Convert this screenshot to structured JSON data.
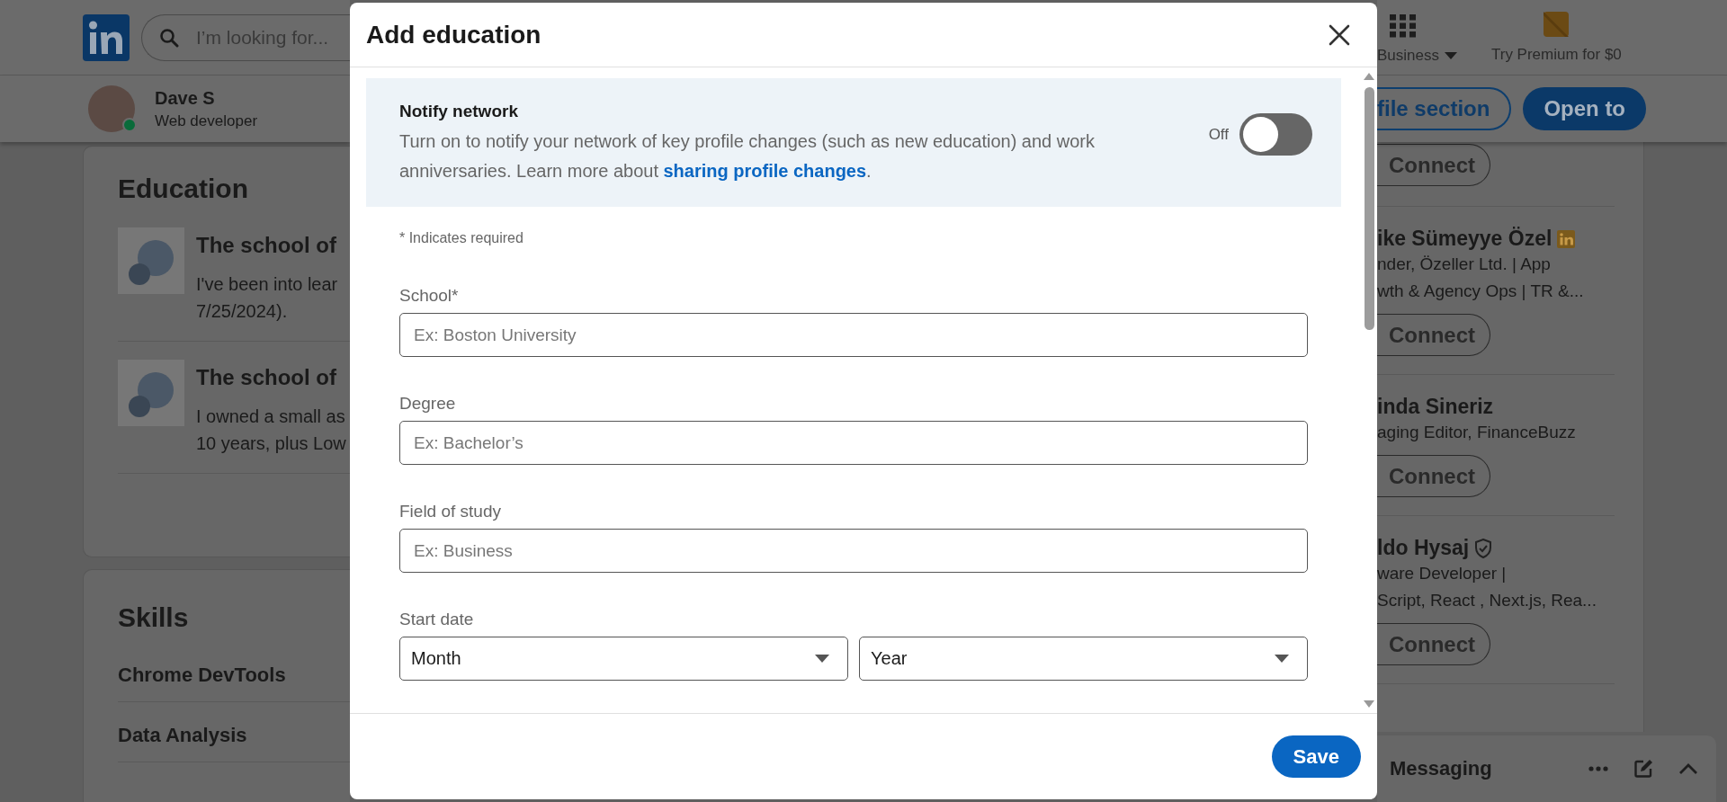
{
  "background_page": {
    "nav": {
      "search_placeholder": "I’m looking for...",
      "business_label": "Business",
      "premium_label": "Try Premium for $0"
    },
    "profile_bar": {
      "name": "Dave S",
      "headline": "Web developer",
      "online": true,
      "buttons": [
        {
          "label": "file section",
          "kind": "outline"
        },
        {
          "label": "Open to",
          "kind": "filled"
        }
      ]
    },
    "education": {
      "title": "Education",
      "items": [
        {
          "title": "The school of",
          "description_lines": [
            "I've been into lear",
            "7/25/2024)."
          ]
        },
        {
          "title": "The school of",
          "description_lines": [
            "I owned a small as",
            "10 years, plus Low"
          ]
        }
      ]
    },
    "skills": {
      "title": "Skills",
      "items": [
        "Chrome DevTools",
        "Data Analysis"
      ]
    },
    "suggestions": [
      {
        "kind": "connect_only",
        "connect_label": "Connect"
      },
      {
        "kind": "premium",
        "name": "ike Sümeyye Özel",
        "headline_lines": [
          "nder, Özeller Ltd. | App",
          "wth & Agency Ops | TR &..."
        ],
        "connect_label": "Connect"
      },
      {
        "kind": "plain",
        "name": "inda Sineriz",
        "headline_lines": [
          "aging Editor, FinanceBuzz"
        ],
        "connect_label": "Connect"
      },
      {
        "kind": "verified",
        "name": "ldo Hysaj",
        "headline_lines": [
          "ware Developer |",
          "Script, React , Next.js, Rea..."
        ],
        "connect_label": "Connect"
      }
    ],
    "messaging": {
      "label": "Messaging"
    }
  },
  "modal": {
    "title": "Add education",
    "notify": {
      "title": "Notify network",
      "text_before": "Turn on to notify your network of key profile changes (such as new education) and work anniversaries. Learn more about ",
      "link": "sharing profile changes",
      "text_after": ".",
      "toggle_label": "Off",
      "on": false
    },
    "required_note": "* Indicates required",
    "fields": [
      {
        "kind": "text",
        "label": "School*",
        "placeholder": "Ex: Boston University"
      },
      {
        "kind": "text",
        "label": "Degree",
        "placeholder": "Ex: Bachelor’s"
      },
      {
        "kind": "text",
        "label": "Field of study",
        "placeholder": "Ex: Business"
      },
      {
        "kind": "date",
        "label": "Start date",
        "selects": [
          "Month",
          "Year"
        ]
      }
    ],
    "save_label": "Save"
  }
}
